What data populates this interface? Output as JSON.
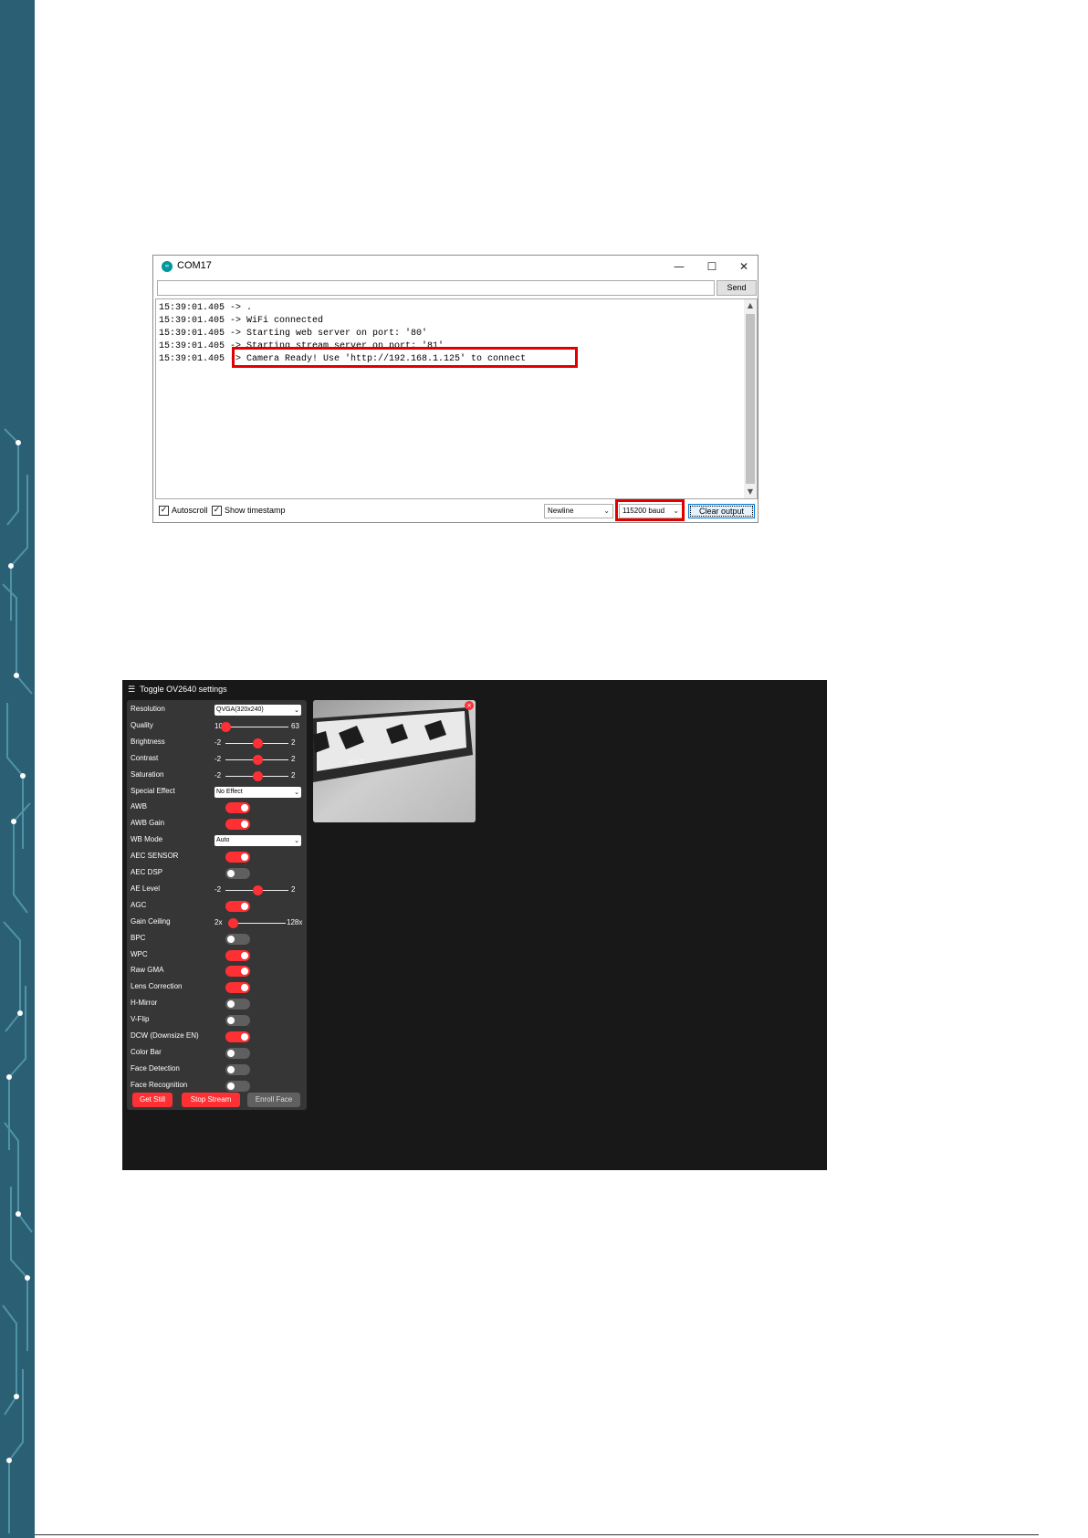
{
  "serial_monitor": {
    "title": "COM17",
    "logo_text": "∞",
    "controls": {
      "minimize": "—",
      "maximize": "☐",
      "close": "✕"
    },
    "send_value": "",
    "send_label": "Send",
    "log_lines": [
      "15:39:01.405 -> .",
      "15:39:01.405 -> WiFi connected",
      "15:39:01.405 -> Starting web server on port: '80'",
      "15:39:01.405 -> Starting stream server on port: '81'",
      "15:39:01.405 -> Camera Ready! Use 'http://192.168.1.125' to connect"
    ],
    "autoscroll_label": "Autoscroll",
    "autoscroll_checked": true,
    "timestamp_label": "Show timestamp",
    "timestamp_checked": true,
    "line_ending": "Newline",
    "baud": "115200 baud",
    "clear_label": "Clear output",
    "highlight_color": "#e00000"
  },
  "web_ui": {
    "menu_icon": "☰",
    "toggle_label": "Toggle OV2640 settings",
    "accent": "#ff3034",
    "rows": [
      {
        "label": "Resolution",
        "kind": "select",
        "value": "QVGA(320x240)"
      },
      {
        "label": "Quality",
        "kind": "range",
        "min": "10",
        "max": "63",
        "value": 10,
        "lo": 10,
        "hi": 63
      },
      {
        "label": "Brightness",
        "kind": "range",
        "min": "-2",
        "max": "2",
        "value": 0,
        "lo": -2,
        "hi": 2
      },
      {
        "label": "Contrast",
        "kind": "range",
        "min": "-2",
        "max": "2",
        "value": 0,
        "lo": -2,
        "hi": 2
      },
      {
        "label": "Saturation",
        "kind": "range",
        "min": "-2",
        "max": "2",
        "value": 0,
        "lo": -2,
        "hi": 2
      },
      {
        "label": "Special Effect",
        "kind": "select",
        "value": "No Effect"
      },
      {
        "label": "AWB",
        "kind": "toggle",
        "on": true
      },
      {
        "label": "AWB Gain",
        "kind": "toggle",
        "on": true
      },
      {
        "label": "WB Mode",
        "kind": "select",
        "value": "Auto"
      },
      {
        "label": "AEC SENSOR",
        "kind": "toggle",
        "on": true
      },
      {
        "label": "AEC DSP",
        "kind": "toggle",
        "on": false
      },
      {
        "label": "AE Level",
        "kind": "range",
        "min": "-2",
        "max": "2",
        "value": 0,
        "lo": -2,
        "hi": 2
      },
      {
        "label": "AGC",
        "kind": "toggle",
        "on": true
      },
      {
        "label": "Gain Ceiling",
        "kind": "range",
        "min": "2x",
        "max": "128x",
        "value": 0,
        "lo": 0,
        "hi": 6
      },
      {
        "label": "BPC",
        "kind": "toggle",
        "on": false
      },
      {
        "label": "WPC",
        "kind": "toggle",
        "on": true
      },
      {
        "label": "Raw GMA",
        "kind": "toggle",
        "on": true
      },
      {
        "label": "Lens Correction",
        "kind": "toggle",
        "on": true
      },
      {
        "label": "H-Mirror",
        "kind": "toggle",
        "on": false
      },
      {
        "label": "V-Flip",
        "kind": "toggle",
        "on": false
      },
      {
        "label": "DCW (Downsize EN)",
        "kind": "toggle",
        "on": true
      },
      {
        "label": "Color Bar",
        "kind": "toggle",
        "on": false
      },
      {
        "label": "Face Detection",
        "kind": "toggle",
        "on": false
      },
      {
        "label": "Face Recognition",
        "kind": "toggle",
        "on": false
      }
    ],
    "buttons": {
      "get_still": "Get Still",
      "stop_stream": "Stop Stream",
      "enroll_face": "Enroll Face"
    },
    "close_icon": "×",
    "caret": "⌄"
  }
}
